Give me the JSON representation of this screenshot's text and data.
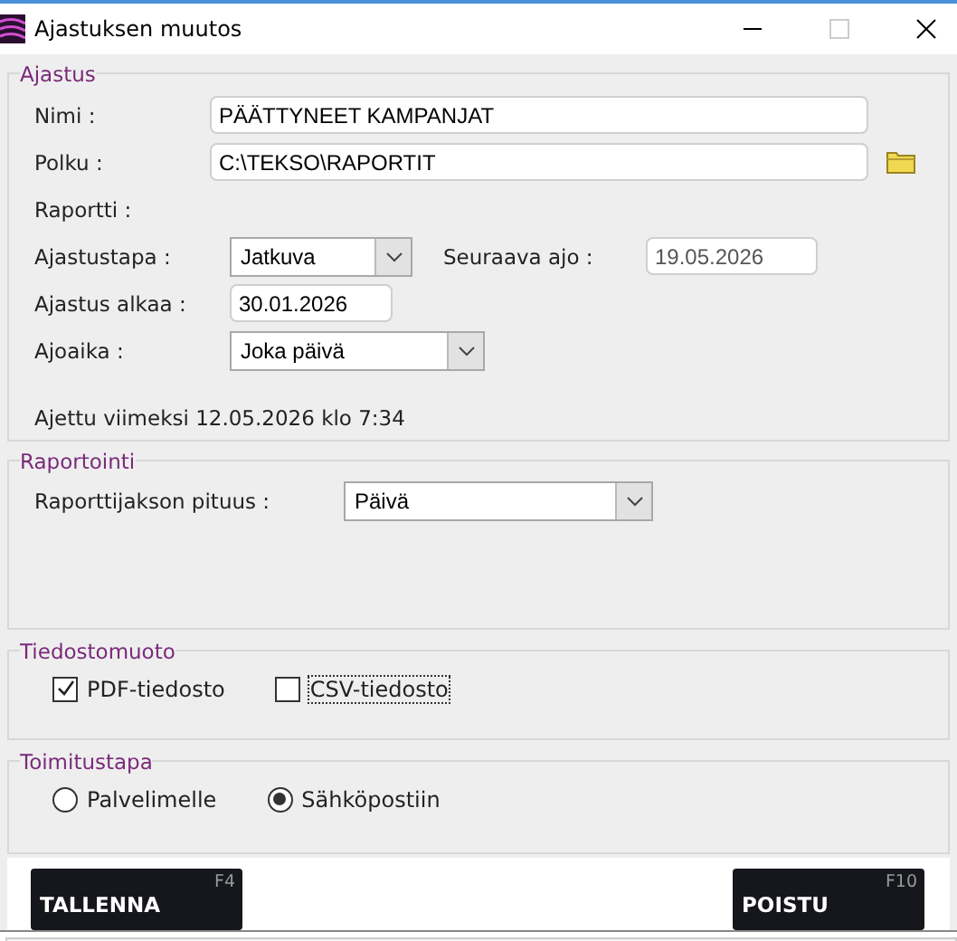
{
  "window": {
    "title": "Ajastuksen muutos"
  },
  "schedule": {
    "legend": "Ajastus",
    "name": {
      "label": "Nimi :",
      "value": "PÄÄTTYNEET KAMPANJAT"
    },
    "path": {
      "label": "Polku :",
      "value": "C:\\TEKSO\\RAPORTIT"
    },
    "report": {
      "label": "Raportti :"
    },
    "type": {
      "label": "Ajastustapa :",
      "value": "Jatkuva"
    },
    "next_run": {
      "label": "Seuraava ajo :",
      "value": "19.05.2026"
    },
    "start": {
      "label": "Ajastus alkaa :",
      "value": "30.01.2026"
    },
    "run_time": {
      "label": "Ajoaika :",
      "value": "Joka päivä"
    },
    "last_run": "Ajettu viimeksi 12.05.2026 klo 7:34"
  },
  "reporting": {
    "legend": "Raportointi",
    "period": {
      "label": "Raporttijakson pituus :",
      "value": "Päivä"
    }
  },
  "file_format": {
    "legend": "Tiedostomuoto",
    "options": [
      {
        "label": "PDF-tiedosto",
        "checked": true
      },
      {
        "label": "CSV-tiedosto",
        "checked": false
      }
    ]
  },
  "delivery": {
    "legend": "Toimitustapa",
    "options": [
      {
        "label": "Palvelimelle",
        "selected": false
      },
      {
        "label": "Sähköpostiin",
        "selected": true
      }
    ]
  },
  "buttons": [
    {
      "label": "TALLENNA",
      "key": "F4"
    },
    {
      "label": "POISTU",
      "key": "F10"
    }
  ]
}
